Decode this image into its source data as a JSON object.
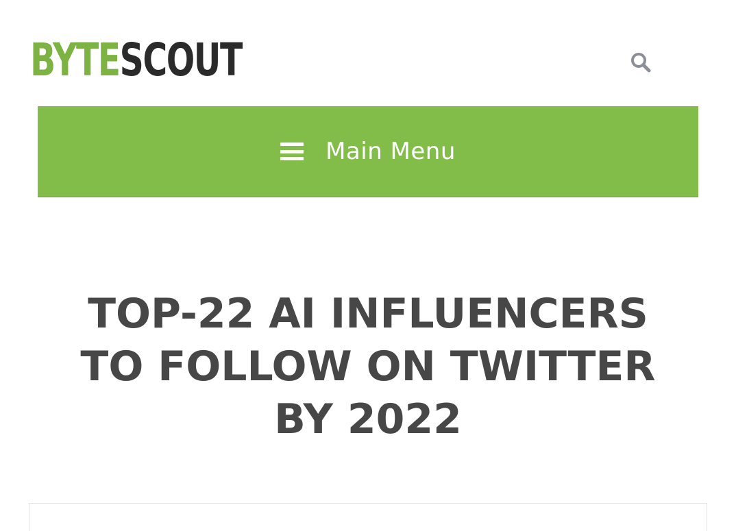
{
  "header": {
    "logo": {
      "part1": "BYTE",
      "part2": "SCOUT"
    },
    "search_icon": "search-icon"
  },
  "nav": {
    "menu_icon": "hamburger-icon",
    "menu_label": "Main Menu"
  },
  "article": {
    "title_lines": [
      "TOP-22 AI INFLUENCERS",
      "TO FOLLOW ON TWITTER",
      "BY 2022"
    ]
  },
  "colors": {
    "brand_green": "#82bc49",
    "logo_green": "#7cb342",
    "logo_dark": "#2b2b2b",
    "title_text": "#474747",
    "icon_gray": "#8a8f98"
  }
}
